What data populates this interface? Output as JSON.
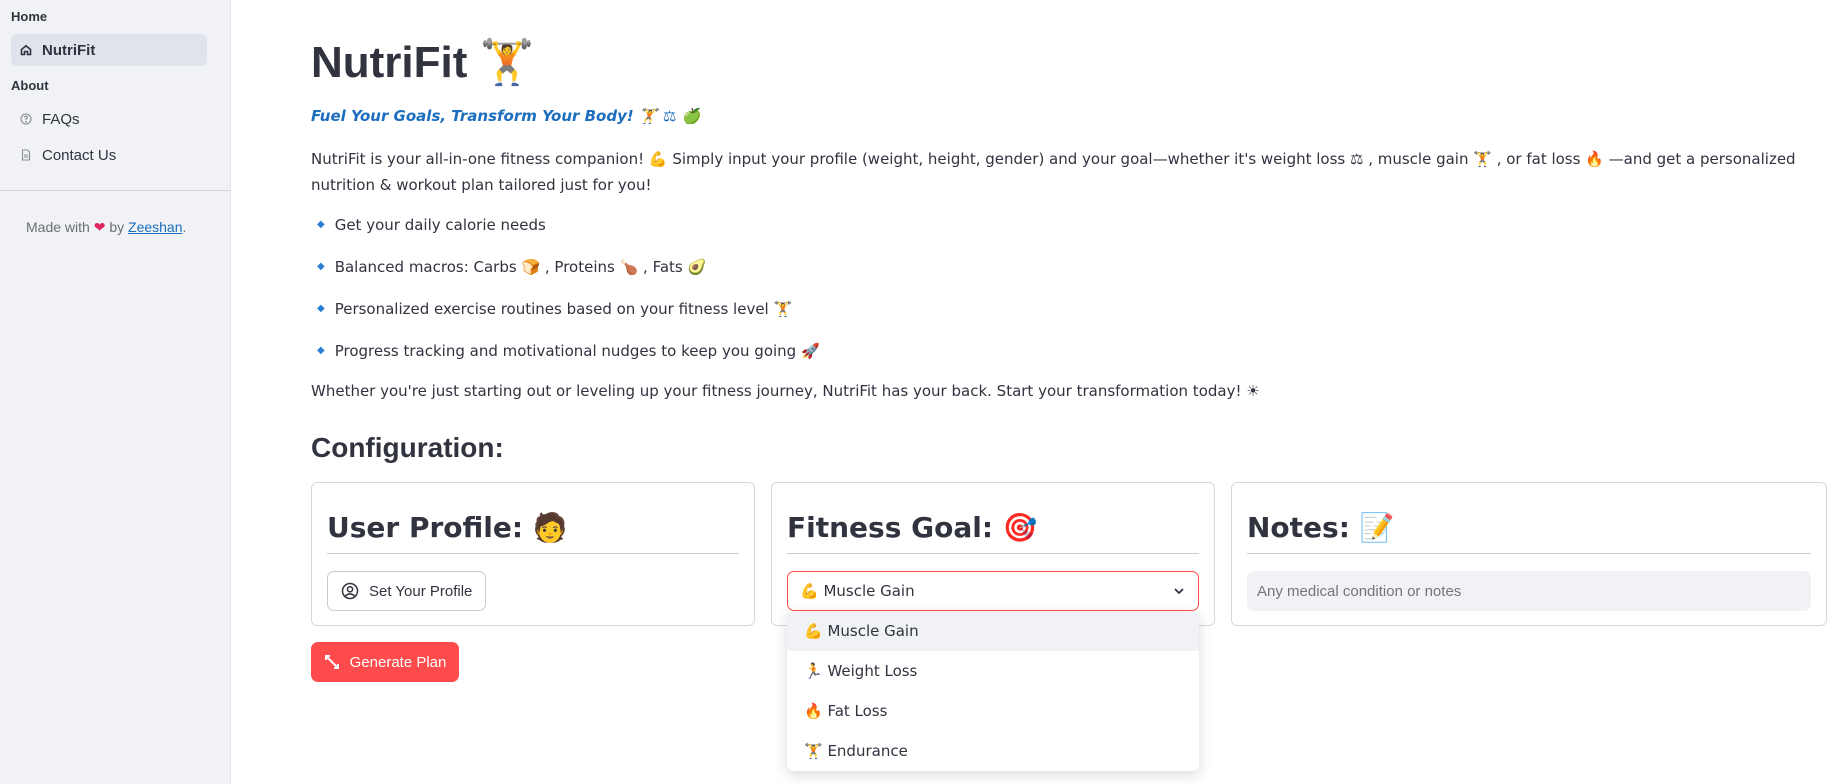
{
  "sidebar": {
    "section_home": "Home",
    "section_about": "About",
    "items": [
      {
        "label": "NutriFit",
        "icon": "home-icon",
        "active": true
      },
      {
        "label": "FAQs",
        "icon": "help-circle-icon",
        "active": false
      },
      {
        "label": "Contact Us",
        "icon": "document-icon",
        "active": false
      }
    ],
    "footer": {
      "prefix": "Made with",
      "heart": "❤",
      "by": "by",
      "link": "Zeeshan",
      "suffix": "."
    }
  },
  "main": {
    "title": "NutriFit",
    "title_emoji": "🏋",
    "tagline": "Fuel Your Goals, Transform Your Body! 🏋 ⚖ 🍏",
    "description": "NutriFit is your all-in-one fitness companion! 💪 Simply input your profile (weight, height, gender) and your goal—whether it's weight loss ⚖ , muscle gain 🏋 , or fat loss 🔥 —and get a personalized nutrition & workout plan tailored just for you!",
    "bullets": [
      "Get your daily calorie needs",
      "Balanced macros: Carbs 🍞 , Proteins 🍗 , Fats 🥑",
      "Personalized exercise routines based on your fitness level 🏋",
      "Progress tracking and motivational nudges to keep you going 🚀"
    ],
    "closing": "Whether you're just starting out or leveling up your fitness journey, NutriFit has your back. Start your transformation today! ☀",
    "config_heading": "Configuration:",
    "user_profile": {
      "heading": "User Profile: 🧑",
      "button": "Set Your Profile"
    },
    "fitness_goal": {
      "heading": "Fitness Goal: 🎯",
      "selected": "💪 Muscle Gain"
    },
    "notes": {
      "heading": "Notes: 📝",
      "placeholder": "Any medical condition or notes"
    },
    "generate_button": "Generate Plan"
  },
  "dropdown": {
    "options": [
      "💪 Muscle Gain",
      "🏃 Weight Loss",
      "🔥 Fat Loss",
      "🏋 Endurance"
    ],
    "highlighted_index": 0
  },
  "colors": {
    "accent": "#ff4b4b",
    "link": "#1c6ebf",
    "sidebar_bg": "#f0f2f6"
  }
}
